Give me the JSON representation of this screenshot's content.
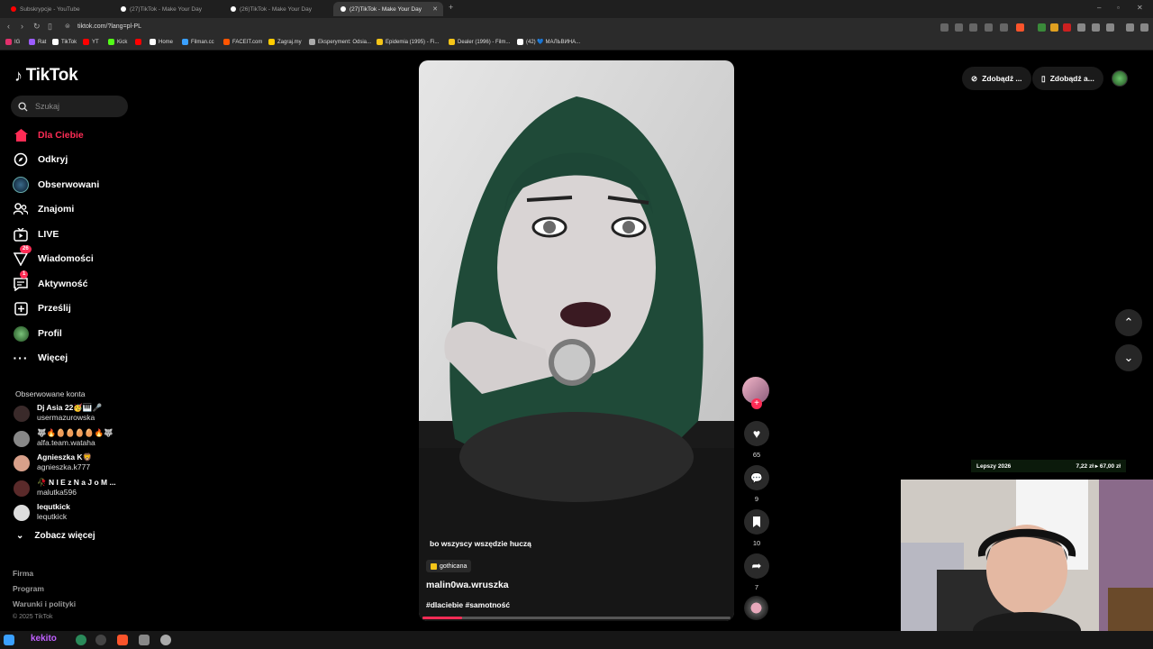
{
  "browser": {
    "tabs": [
      {
        "title": "Subskrypcje - YouTube",
        "active": false,
        "color": "#ff0000"
      },
      {
        "title": "(27)TikTok - Make Your Day",
        "active": false,
        "color": "#ffffff"
      },
      {
        "title": "(26)TikTok - Make Your Day",
        "active": false,
        "color": "#ffffff"
      },
      {
        "title": "(27)TikTok - Make Your Day",
        "active": true,
        "color": "#ffffff"
      }
    ],
    "url": "tiktok.com/?lang=pl-PL",
    "bookmarks": [
      {
        "label": "IG",
        "color": "#e1306c"
      },
      {
        "label": "Rat",
        "color": "#9c5cff"
      },
      {
        "label": "TikTok",
        "color": "#ffffff"
      },
      {
        "label": "YT",
        "color": "#ff0000"
      },
      {
        "label": "Kick",
        "color": "#53fc18"
      },
      {
        "label": "",
        "color": "#ff0000"
      },
      {
        "label": "Home",
        "color": "#ffffff"
      },
      {
        "label": "Filman.cc",
        "color": "#3aa0ff"
      },
      {
        "label": "FACEIT.com",
        "color": "#ff5500"
      },
      {
        "label": "Zagraj.my",
        "color": "#ffcc00"
      },
      {
        "label": "Eksperyment: Odsia...",
        "color": "#aaaaaa"
      },
      {
        "label": "Epidemia (1995) - Fi...",
        "color": "#f5c518"
      },
      {
        "label": "Dealer (1996) - Film...",
        "color": "#f5c518"
      },
      {
        "label": "(42) 💙 МАЛЬВИНА...",
        "color": "#ffffff"
      }
    ]
  },
  "sidebar": {
    "logo": "TikTok",
    "search_placeholder": "Szukaj",
    "nav": [
      {
        "label": "Dla Ciebie",
        "icon": "home-icon",
        "active": true,
        "badge": ""
      },
      {
        "label": "Odkryj",
        "icon": "compass-icon",
        "active": false,
        "badge": ""
      },
      {
        "label": "Obserwowani",
        "icon": "following-avatar-icon",
        "active": false,
        "badge": ""
      },
      {
        "label": "Znajomi",
        "icon": "friends-icon",
        "active": false,
        "badge": ""
      },
      {
        "label": "LIVE",
        "icon": "live-icon",
        "active": false,
        "badge": ""
      },
      {
        "label": "Wiadomości",
        "icon": "messages-icon",
        "active": false,
        "badge": "26"
      },
      {
        "label": "Aktywność",
        "icon": "activity-icon",
        "active": false,
        "badge": "1"
      },
      {
        "label": "Prześlij",
        "icon": "upload-icon",
        "active": false,
        "badge": ""
      },
      {
        "label": "Profil",
        "icon": "profile-avatar-icon",
        "active": false,
        "badge": ""
      },
      {
        "label": "Więcej",
        "icon": "more-dots-icon",
        "active": false,
        "badge": ""
      }
    ],
    "followed_title": "Obserwowane konta",
    "accounts": [
      {
        "name": "Dj Asia 22🥳🎹🎤",
        "handle": "usermazurowska",
        "color": "#3a2a2a"
      },
      {
        "name": "🐺🔥🥚🥚🥚🥚🔥🐺",
        "handle": "alfa.team.wataha",
        "color": "#888888"
      },
      {
        "name": "Agnieszka K🦁",
        "handle": "agnieszka.k777",
        "color": "#d8a08a"
      },
      {
        "name": "🥀 N I E z N a J o M ...",
        "handle": "malutka596",
        "color": "#5a2a2a"
      },
      {
        "name": "lequtkick",
        "handle": "lequtkick",
        "color": "#dddddd"
      }
    ],
    "see_more": "Zobacz więcej",
    "footer": [
      "Firma",
      "Program",
      "Warunki i polityki"
    ],
    "copyright": "© 2025 TikTok"
  },
  "header": {
    "coins_label": "Zdobądź ...",
    "app_label": "Zdobądź a..."
  },
  "video": {
    "caption": "bo wszyscy wszędzie huczą",
    "sound_tag": "gothicana",
    "author": "malin0wa.wruszka",
    "hashtags": "#dlaciebie #samotność",
    "progress": 0.13,
    "likes": "65",
    "comments": "9",
    "saves": "10",
    "shares": "7"
  },
  "overlay": {
    "left_text": "Lepszy 2026",
    "right_text": "7,22 zł ▸ 67,00 zł"
  },
  "taskbar": {
    "label": "kekito"
  }
}
